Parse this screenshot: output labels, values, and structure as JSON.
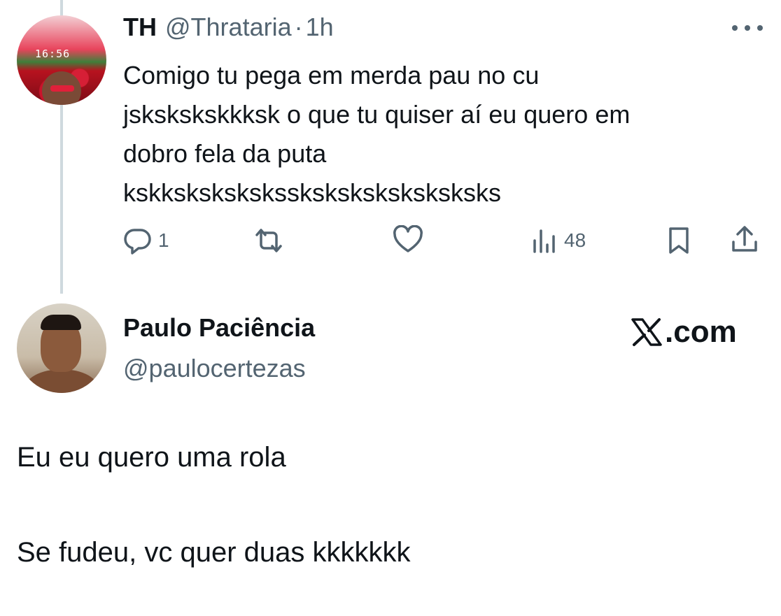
{
  "parent_tweet": {
    "author_name": "TH",
    "handle": "@Thrataria",
    "separator": "·",
    "time": "1h",
    "avatar_overlay_time": "16:56",
    "text": "Comigo tu pega em merda pau no cu\njskskskskkksk o que tu quiser aí eu quero em\ndobro fela da puta\nkskkskskskskssksksksksksksksks",
    "metrics": {
      "replies": "1",
      "views": "48"
    },
    "icons": [
      "more-icon",
      "reply-icon",
      "retweet-icon",
      "like-icon",
      "views-icon",
      "bookmark-icon",
      "share-icon"
    ]
  },
  "main_tweet": {
    "author_name": "Paulo Paciência",
    "handle": "@paulocertezas",
    "brand": ".com",
    "text": "Eu eu quero uma rola\n\nSe fudeu, vc quer duas kkkkkkk"
  },
  "colors": {
    "text_primary": "#0f1419",
    "text_secondary": "#536471",
    "thread_line": "#cfd9de"
  }
}
